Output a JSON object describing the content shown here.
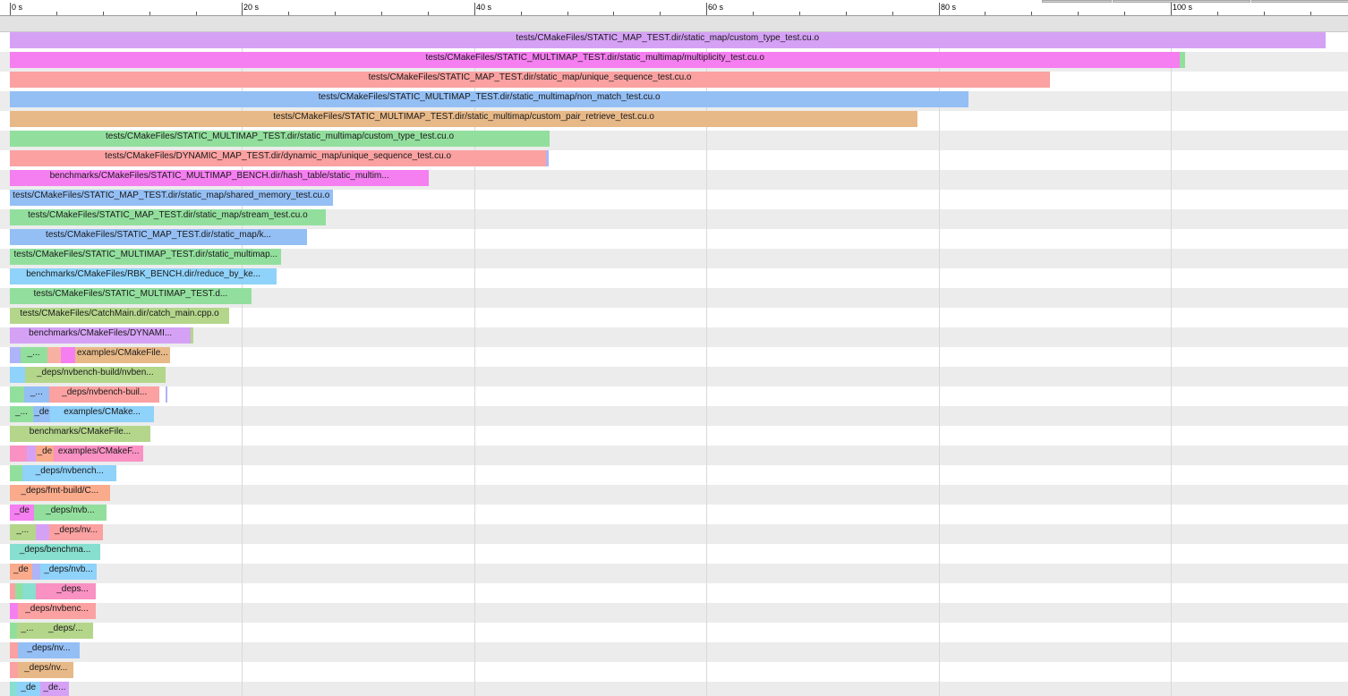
{
  "axis": {
    "unit": "s",
    "ticks": [
      "0 s",
      "20 s",
      "40 s",
      "60 s",
      "80 s",
      "100 s"
    ]
  },
  "colors": {
    "purple": "#d5a1f5",
    "magenta": "#f57ef1",
    "salmon": "#fba1a1",
    "blue": "#94bff5",
    "tan": "#e8b988",
    "green": "#92df9d",
    "olive": "#b4d68b",
    "skyblue": "#8fd2fa",
    "lightsalmon": "#f9ab8c",
    "pink": "#f991c3",
    "teal": "#86dfcf",
    "lavender": "#adb4f7",
    "peach": "#f7b1a2"
  },
  "tasks": [
    {
      "row": 0,
      "start": 0,
      "end": 113.3,
      "color": "purple",
      "label": "tests/CMakeFiles/STATIC_MAP_TEST.dir/static_map/custom_type_test.cu.o"
    },
    {
      "row": 1,
      "start": 0,
      "end": 100.8,
      "color": "magenta",
      "label": "tests/CMakeFiles/STATIC_MULTIMAP_TEST.dir/static_multimap/multiplicity_test.cu.o"
    },
    {
      "row": 1,
      "start": 100.8,
      "end": 101.2,
      "color": "green",
      "label": ""
    },
    {
      "row": 2,
      "start": 0,
      "end": 89.6,
      "color": "salmon",
      "label": "tests/CMakeFiles/STATIC_MAP_TEST.dir/static_map/unique_sequence_test.cu.o"
    },
    {
      "row": 3,
      "start": 0,
      "end": 82.6,
      "color": "blue",
      "label": "tests/CMakeFiles/STATIC_MULTIMAP_TEST.dir/static_multimap/non_match_test.cu.o"
    },
    {
      "row": 4,
      "start": 0,
      "end": 78.2,
      "color": "tan",
      "label": "tests/CMakeFiles/STATIC_MULTIMAP_TEST.dir/static_multimap/custom_pair_retrieve_test.cu.o"
    },
    {
      "row": 5,
      "start": 0,
      "end": 46.5,
      "color": "green",
      "label": "tests/CMakeFiles/STATIC_MULTIMAP_TEST.dir/static_multimap/custom_type_test.cu.o"
    },
    {
      "row": 6,
      "start": 0,
      "end": 46.2,
      "color": "salmon",
      "label": "tests/CMakeFiles/DYNAMIC_MAP_TEST.dir/dynamic_map/unique_sequence_test.cu.o"
    },
    {
      "row": 6,
      "start": 46.2,
      "end": 46.4,
      "color": "lavender",
      "label": ""
    },
    {
      "row": 7,
      "start": 0,
      "end": 36.1,
      "color": "magenta",
      "label": "benchmarks/CMakeFiles/STATIC_MULTIMAP_BENCH.dir/hash_table/static_multim..."
    },
    {
      "row": 8,
      "start": 0,
      "end": 27.8,
      "color": "blue",
      "label": "tests/CMakeFiles/STATIC_MAP_TEST.dir/static_map/shared_memory_test.cu.o"
    },
    {
      "row": 9,
      "start": 0,
      "end": 27.2,
      "color": "green",
      "label": "tests/CMakeFiles/STATIC_MAP_TEST.dir/static_map/stream_test.cu.o"
    },
    {
      "row": 10,
      "start": 0,
      "end": 25.6,
      "color": "blue",
      "label": "tests/CMakeFiles/STATIC_MAP_TEST.dir/static_map/k..."
    },
    {
      "row": 11,
      "start": 0,
      "end": 23.4,
      "color": "green",
      "label": "tests/CMakeFiles/STATIC_MULTIMAP_TEST.dir/static_multimap..."
    },
    {
      "row": 12,
      "start": 0,
      "end": 23.0,
      "color": "skyblue",
      "label": "benchmarks/CMakeFiles/RBK_BENCH.dir/reduce_by_ke..."
    },
    {
      "row": 13,
      "start": 0,
      "end": 20.8,
      "color": "green",
      "label": "tests/CMakeFiles/STATIC_MULTIMAP_TEST.d..."
    },
    {
      "row": 14,
      "start": 0,
      "end": 18.9,
      "color": "olive",
      "label": "tests/CMakeFiles/CatchMain.dir/catch_main.cpp.o"
    },
    {
      "row": 15,
      "start": 0,
      "end": 15.6,
      "color": "purple",
      "label": "benchmarks/CMakeFiles/DYNAMI..."
    },
    {
      "row": 15,
      "start": 15.6,
      "end": 15.8,
      "color": "olive",
      "label": ""
    },
    {
      "row": 16,
      "start": 0,
      "end": 0.9,
      "color": "lavender",
      "label": ""
    },
    {
      "row": 16,
      "start": 0.9,
      "end": 3.2,
      "color": "green",
      "label": "_..."
    },
    {
      "row": 16,
      "start": 3.2,
      "end": 4.4,
      "color": "peach",
      "label": ""
    },
    {
      "row": 16,
      "start": 4.4,
      "end": 5.6,
      "color": "magenta",
      "label": ""
    },
    {
      "row": 16,
      "start": 5.6,
      "end": 13.8,
      "color": "tan",
      "label": "examples/CMakeFile..."
    },
    {
      "row": 17,
      "start": 0,
      "end": 1.3,
      "color": "skyblue",
      "label": ""
    },
    {
      "row": 17,
      "start": 1.3,
      "end": 13.4,
      "color": "olive",
      "label": "_deps/nvbench-build/nvben..."
    },
    {
      "row": 18,
      "start": 0,
      "end": 1.2,
      "color": "green",
      "label": ""
    },
    {
      "row": 18,
      "start": 1.2,
      "end": 3.4,
      "color": "blue",
      "label": "_..."
    },
    {
      "row": 18,
      "start": 3.4,
      "end": 12.9,
      "color": "salmon",
      "label": "_deps/nvbench-buil..."
    },
    {
      "row": 18,
      "start": 13.4,
      "end": 13.6,
      "color": "lavender",
      "label": ""
    },
    {
      "row": 19,
      "start": 0,
      "end": 2.0,
      "color": "green",
      "label": "_..."
    },
    {
      "row": 19,
      "start": 2.0,
      "end": 3.5,
      "color": "blue",
      "label": "_de"
    },
    {
      "row": 19,
      "start": 3.5,
      "end": 12.4,
      "color": "skyblue",
      "label": "examples/CMake..."
    },
    {
      "row": 20,
      "start": 0,
      "end": 12.1,
      "color": "olive",
      "label": "benchmarks/CMakeFile..."
    },
    {
      "row": 21,
      "start": 0,
      "end": 1.5,
      "color": "pink",
      "label": ""
    },
    {
      "row": 21,
      "start": 1.5,
      "end": 2.2,
      "color": "purple",
      "label": ""
    },
    {
      "row": 21,
      "start": 2.2,
      "end": 3.8,
      "color": "lightsalmon",
      "label": "_de"
    },
    {
      "row": 21,
      "start": 3.8,
      "end": 11.5,
      "color": "pink",
      "label": "examples/CMakeF..."
    },
    {
      "row": 22,
      "start": 0,
      "end": 1.1,
      "color": "green",
      "label": ""
    },
    {
      "row": 22,
      "start": 1.1,
      "end": 9.2,
      "color": "skyblue",
      "label": "_deps/nvbench..."
    },
    {
      "row": 23,
      "start": 0,
      "end": 8.6,
      "color": "lightsalmon",
      "label": "_deps/fmt-build/C..."
    },
    {
      "row": 24,
      "start": 0,
      "end": 2.1,
      "color": "magenta",
      "label": "_de"
    },
    {
      "row": 24,
      "start": 2.1,
      "end": 8.3,
      "color": "green",
      "label": "_deps/nvb..."
    },
    {
      "row": 25,
      "start": 0,
      "end": 2.2,
      "color": "olive",
      "label": "_..."
    },
    {
      "row": 25,
      "start": 2.2,
      "end": 3.4,
      "color": "purple",
      "label": ""
    },
    {
      "row": 25,
      "start": 3.4,
      "end": 8.0,
      "color": "salmon",
      "label": "_deps/nv..."
    },
    {
      "row": 26,
      "start": 0,
      "end": 7.8,
      "color": "teal",
      "label": "_deps/benchma..."
    },
    {
      "row": 27,
      "start": 0,
      "end": 1.9,
      "color": "lightsalmon",
      "label": "_de"
    },
    {
      "row": 27,
      "start": 1.9,
      "end": 2.6,
      "color": "lavender",
      "label": ""
    },
    {
      "row": 27,
      "start": 2.6,
      "end": 7.5,
      "color": "skyblue",
      "label": "_deps/nvb..."
    },
    {
      "row": 28,
      "start": 0,
      "end": 0.5,
      "color": "salmon",
      "label": ""
    },
    {
      "row": 28,
      "start": 0.5,
      "end": 1.1,
      "color": "green",
      "label": ""
    },
    {
      "row": 28,
      "start": 1.1,
      "end": 2.2,
      "color": "teal",
      "label": ""
    },
    {
      "row": 28,
      "start": 2.2,
      "end": 3.4,
      "color": "pink",
      "label": ""
    },
    {
      "row": 28,
      "start": 3.4,
      "end": 7.4,
      "color": "pink",
      "label": "_deps..."
    },
    {
      "row": 29,
      "start": 0,
      "end": 0.7,
      "color": "magenta",
      "label": ""
    },
    {
      "row": 29,
      "start": 0.7,
      "end": 7.4,
      "color": "salmon",
      "label": "_deps/nvbenc..."
    },
    {
      "row": 30,
      "start": 0,
      "end": 1.2,
      "color": "green",
      "label": ""
    },
    {
      "row": 30,
      "start": 0.6,
      "end": 2.4,
      "color": "olive",
      "label": "_..."
    },
    {
      "row": 30,
      "start": 2.4,
      "end": 7.2,
      "color": "olive",
      "label": "_deps/..."
    },
    {
      "row": 31,
      "start": 0,
      "end": 0.7,
      "color": "salmon",
      "label": ""
    },
    {
      "row": 31,
      "start": 0.7,
      "end": 6.0,
      "color": "blue",
      "label": "_deps/nv..."
    },
    {
      "row": 32,
      "start": 0,
      "end": 0.7,
      "color": "salmon",
      "label": ""
    },
    {
      "row": 32,
      "start": 0.7,
      "end": 5.5,
      "color": "tan",
      "label": "_deps/nv..."
    },
    {
      "row": 33,
      "start": 0,
      "end": 0.6,
      "color": "teal",
      "label": ""
    },
    {
      "row": 33,
      "start": 0.6,
      "end": 2.6,
      "color": "skyblue",
      "label": "_de"
    },
    {
      "row": 33,
      "start": 2.6,
      "end": 5.1,
      "color": "purple",
      "label": "_de..."
    }
  ]
}
